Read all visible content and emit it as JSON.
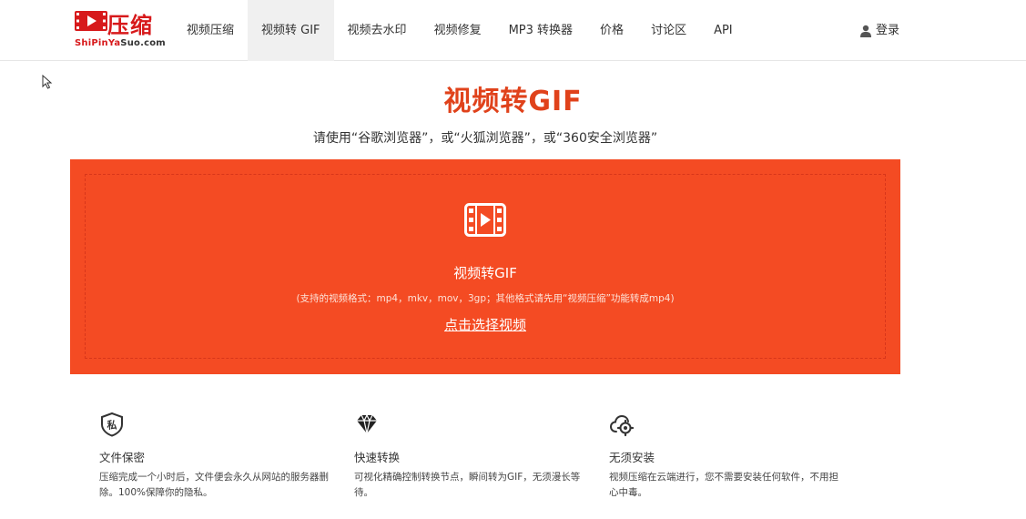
{
  "brand": {
    "name": "压缩",
    "sub_red": "ShiPinYa",
    "sub_dark": "Suo.com",
    "brand_color": "#d7191b"
  },
  "nav": {
    "items": [
      {
        "label": "视频压缩",
        "active": false
      },
      {
        "label": "视频转 GIF",
        "active": true
      },
      {
        "label": "视频去水印",
        "active": false
      },
      {
        "label": "视频修复",
        "active": false
      },
      {
        "label": "MP3 转换器",
        "active": false
      },
      {
        "label": "价格",
        "active": false
      },
      {
        "label": "讨论区",
        "active": false
      },
      {
        "label": "API",
        "active": false
      }
    ],
    "login_label": "登录",
    "login_icon": "user-icon"
  },
  "hero": {
    "title": "视频转GIF",
    "subtitle": "请使用“谷歌浏览器”，或“火狐浏览器”，或“360安全浏览器”",
    "accent_color": "#e0421b"
  },
  "upload": {
    "icon": "film-play-icon",
    "title": "视频转GIF",
    "note": "(支持的视频格式：mp4，mkv，mov，3gp；其他格式请先用“视频压缩”功能转成mp4)",
    "link": "点击选择视频",
    "panel_color": "#f44b23"
  },
  "features": [
    {
      "icon": "privacy-shield-icon",
      "title": "文件保密",
      "desc": "压缩完成一个小时后，文件便会永久从网站的服务器删除。100%保障你的隐私。"
    },
    {
      "icon": "diamond-icon",
      "title": "快速转换",
      "desc": "可视化精确控制转换节点，瞬间转为GIF，无须漫长等待。"
    },
    {
      "icon": "cloud-gear-icon",
      "title": "无须安装",
      "desc": "视频压缩在云端进行，您不需要安装任何软件，不用担心中毒。"
    }
  ]
}
